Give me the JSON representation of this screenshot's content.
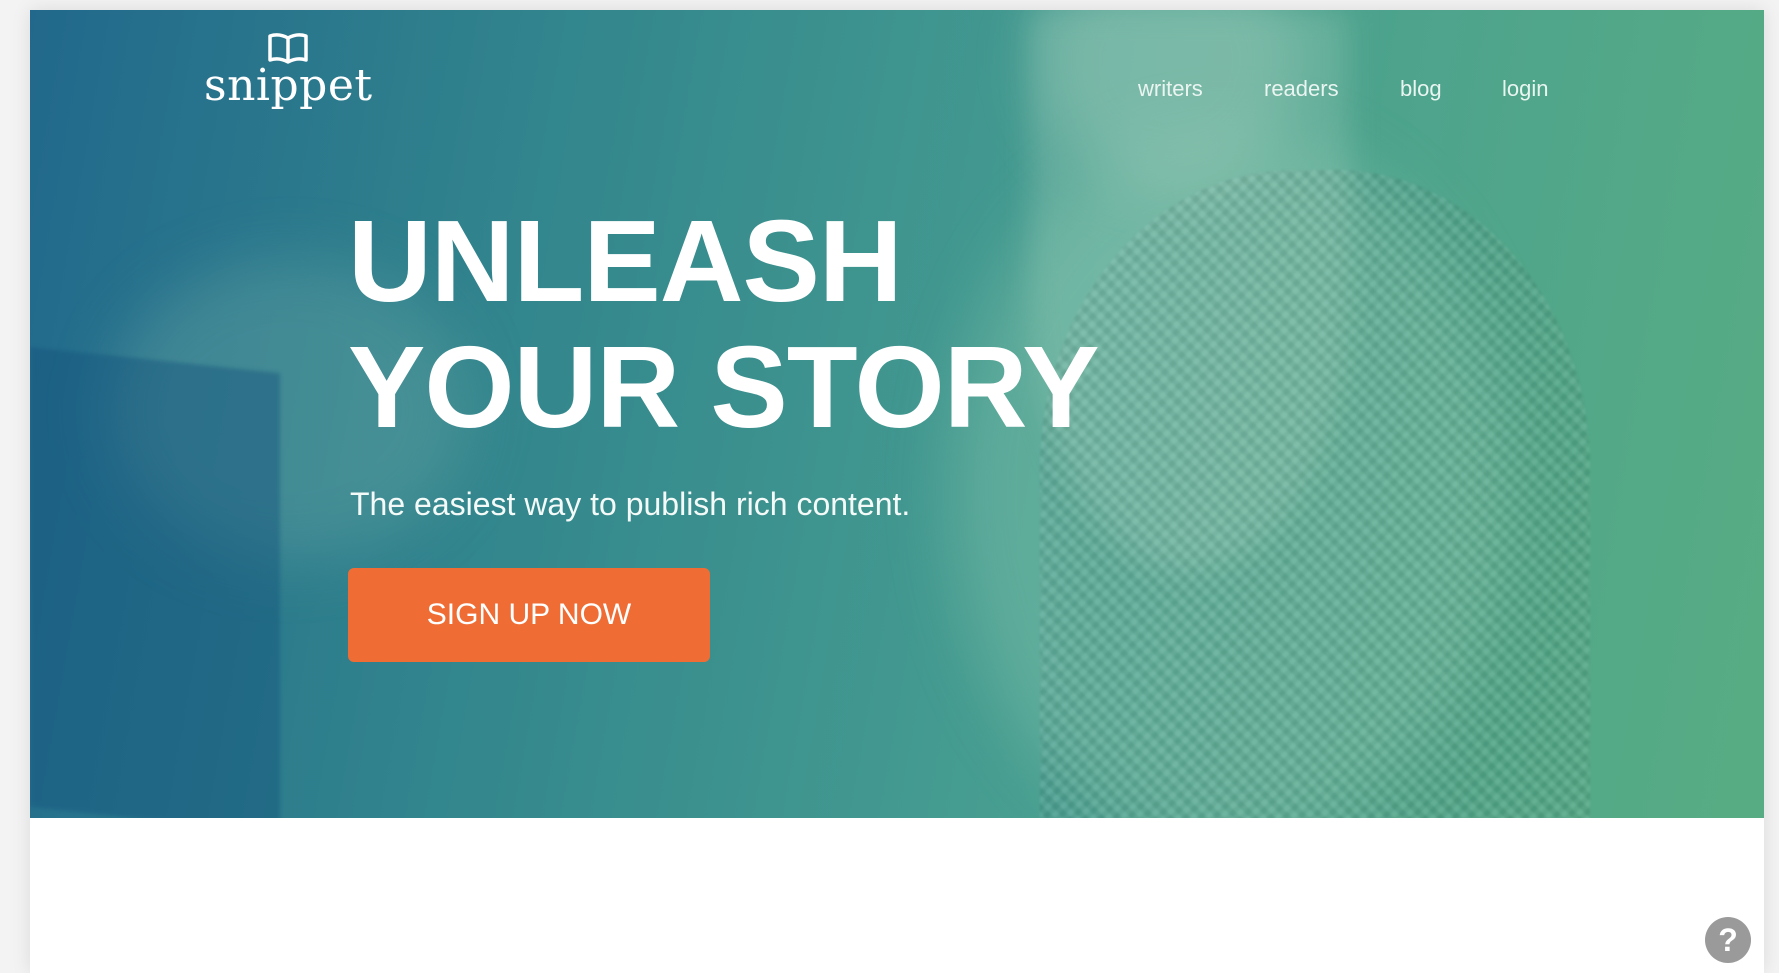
{
  "brand": {
    "logo_text": "snippet",
    "logo_icon": "open-book-icon"
  },
  "nav": {
    "items": [
      {
        "label": "writers"
      },
      {
        "label": "readers"
      },
      {
        "label": "blog"
      },
      {
        "label": "login"
      }
    ]
  },
  "hero": {
    "headline_line1": "UNLEASH",
    "headline_line2": "YOUR STORY",
    "tagline": "The easiest way to publish rich content.",
    "cta_label": "SIGN UP NOW"
  },
  "help": {
    "glyph": "?",
    "icon": "help-icon"
  },
  "colors": {
    "cta": "#ef6d35",
    "hero_start": "#1e648c",
    "hero_end": "#5aaf82",
    "text": "#ffffff"
  }
}
